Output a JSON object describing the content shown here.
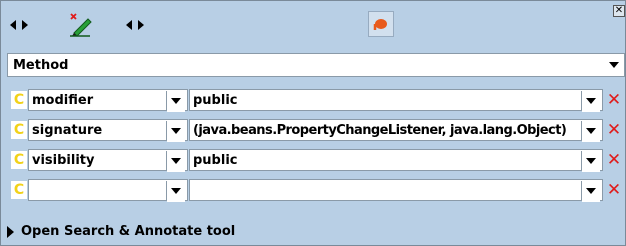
{
  "toolbar": {
    "nav_left_icon": "back-forward-arrows-icon",
    "edit_icon": "pencil-edit-icon",
    "nav_right_icon": "back-forward-arrows-icon",
    "annotate_icon": "annotate-pin-icon",
    "close_label": "✕"
  },
  "method_combo": {
    "value": "Method"
  },
  "rows": [
    {
      "key": "modifier",
      "value": "public"
    },
    {
      "key": "signature",
      "value": "(java.beans.PropertyChangeListener, java.lang.Object)"
    },
    {
      "key": "visibility",
      "value": "public"
    },
    {
      "key": "",
      "value": ""
    }
  ],
  "row_icon": "C",
  "delete_label": "✕",
  "search": {
    "label": "Open Search & Annotate tool"
  }
}
